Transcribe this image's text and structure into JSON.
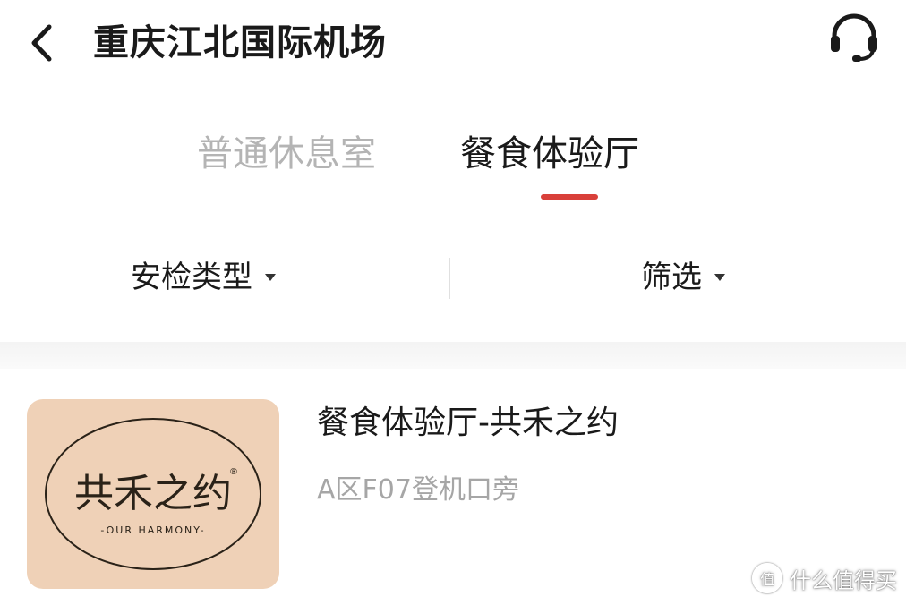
{
  "header": {
    "title": "重庆江北国际机场"
  },
  "tabs": [
    {
      "label": "普通休息室",
      "active": false
    },
    {
      "label": "餐食体验厅",
      "active": true
    }
  ],
  "filters": {
    "security_label": "安检类型",
    "screen_label": "筛选"
  },
  "list": {
    "items": [
      {
        "title": "餐食体验厅-共禾之约",
        "location": "A区F07登机口旁",
        "logo": {
          "name": "共禾之约",
          "subtitle": "-OUR HARMONY-",
          "background": "#efd1b7"
        }
      }
    ]
  },
  "watermark": {
    "text": "什么值得买",
    "mark": "值"
  },
  "colors": {
    "accent": "#d9403a",
    "inactive_tab": "#b4b4b4",
    "secondary_text": "#a6a6a6"
  }
}
